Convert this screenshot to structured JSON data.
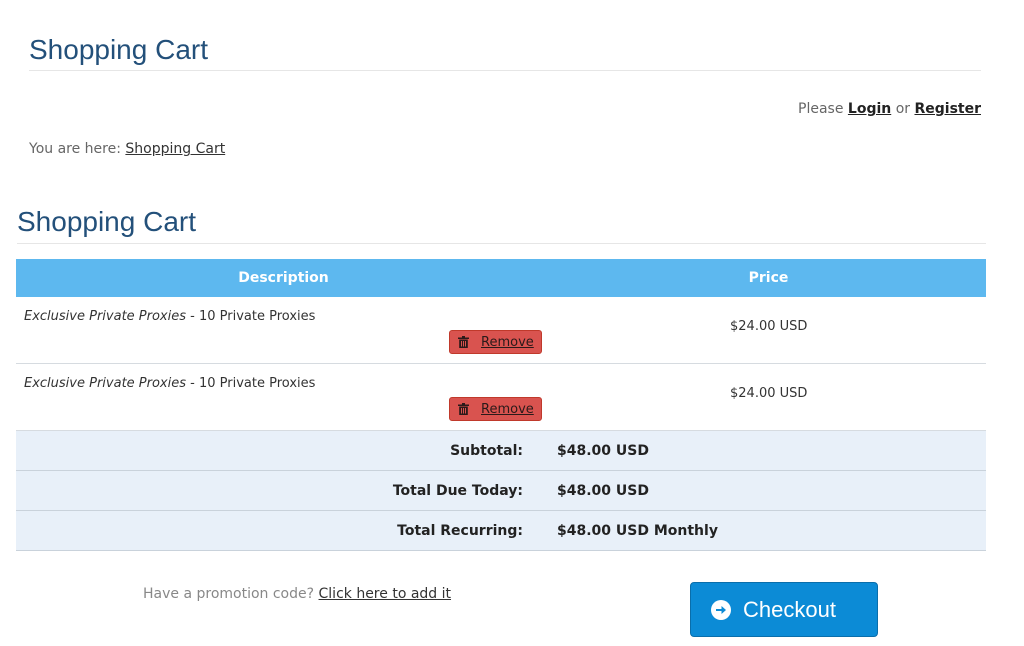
{
  "page": {
    "title": "Shopping Cart"
  },
  "account": {
    "prefix": "Please",
    "login": "Login",
    "or": "or",
    "register": "Register"
  },
  "breadcrumb": {
    "prefix": "You are here:",
    "current": "Shopping Cart"
  },
  "cart": {
    "title": "Shopping Cart",
    "columns": {
      "description": "Description",
      "price": "Price"
    },
    "items": [
      {
        "product": "Exclusive Private Proxies",
        "separator": " - ",
        "option": "10 Private Proxies",
        "remove_label": "Remove",
        "price": "$24.00 USD"
      },
      {
        "product": "Exclusive Private Proxies",
        "separator": " - ",
        "option": "10 Private Proxies",
        "remove_label": "Remove",
        "price": "$24.00 USD"
      }
    ],
    "totals": [
      {
        "label": "Subtotal:",
        "value": "$48.00 USD"
      },
      {
        "label": "Total Due Today:",
        "value": "$48.00 USD"
      },
      {
        "label": "Total Recurring:",
        "value": "$48.00 USD Monthly"
      }
    ]
  },
  "promo": {
    "prompt": "Have a promotion code?",
    "link": "Click here to add it"
  },
  "checkout": {
    "label": "Checkout"
  },
  "colors": {
    "title": "#23507a",
    "header_bg": "#5db8ef",
    "remove_bg": "#d9534f",
    "totals_bg": "#e8f0f9",
    "checkout_bg": "#0c8bd6"
  },
  "icons": {
    "remove": "trash-icon",
    "checkout": "arrow-circle-right-icon"
  }
}
